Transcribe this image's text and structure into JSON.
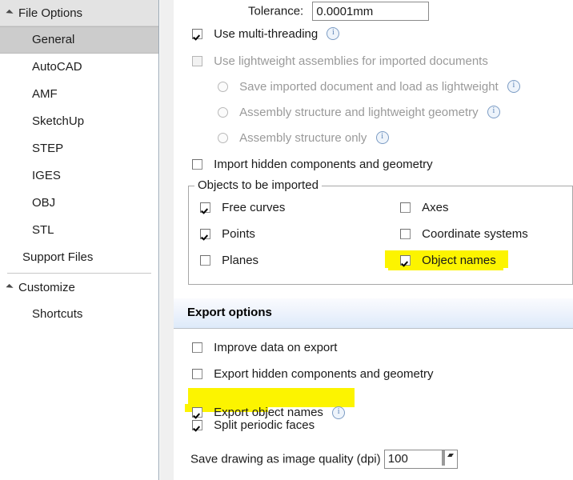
{
  "sidebar": {
    "groups": [
      {
        "label": "File Options",
        "expanded": true
      },
      {
        "label": "Customize",
        "expanded": true
      }
    ],
    "file_options_items": [
      {
        "label": "General",
        "selected": true
      },
      {
        "label": "AutoCAD",
        "selected": false
      },
      {
        "label": "AMF",
        "selected": false
      },
      {
        "label": "SketchUp",
        "selected": false
      },
      {
        "label": "STEP",
        "selected": false
      },
      {
        "label": "IGES",
        "selected": false
      },
      {
        "label": "OBJ",
        "selected": false
      },
      {
        "label": "STL",
        "selected": false
      },
      {
        "label": "Support Files",
        "selected": false
      }
    ],
    "customize_items": [
      {
        "label": "Shortcuts",
        "selected": false
      }
    ]
  },
  "import_options": {
    "tolerance_label": "Tolerance:",
    "tolerance_value": "0.0001mm",
    "multi_threading": {
      "label": "Use multi-threading",
      "checked": true,
      "has_info": true
    },
    "lightweight": {
      "label": "Use lightweight assemblies for imported documents",
      "checked": false,
      "disabled": true
    },
    "lightweight_radios": [
      {
        "label": "Save imported document and load as lightweight",
        "selected": false,
        "has_info": true
      },
      {
        "label": "Assembly structure and lightweight geometry",
        "selected": false,
        "has_info": true
      },
      {
        "label": "Assembly structure only",
        "selected": false,
        "has_info": true
      }
    ],
    "import_hidden": {
      "label": "Import hidden components and geometry",
      "checked": false
    },
    "objects_group": {
      "title": "Objects to be imported",
      "left_column": [
        {
          "label": "Free curves",
          "checked": true,
          "highlighted": false
        },
        {
          "label": "Points",
          "checked": true,
          "highlighted": false
        },
        {
          "label": "Planes",
          "checked": false,
          "highlighted": false
        }
      ],
      "right_column": [
        {
          "label": "Axes",
          "checked": false,
          "highlighted": false
        },
        {
          "label": "Coordinate systems",
          "checked": false,
          "highlighted": false
        },
        {
          "label": "Object names",
          "checked": true,
          "highlighted": true
        }
      ]
    }
  },
  "export_options": {
    "title": "Export options",
    "items": [
      {
        "label": "Improve data on export",
        "checked": false,
        "has_info": false,
        "highlighted": false
      },
      {
        "label": "Export hidden components and geometry",
        "checked": false,
        "has_info": false,
        "highlighted": false
      },
      {
        "label": "Export object names",
        "checked": true,
        "has_info": true,
        "highlighted": true
      },
      {
        "label": "Split periodic faces",
        "checked": true,
        "has_info": false,
        "highlighted": false
      }
    ],
    "dpi_label": "Save drawing as image quality (dpi)",
    "dpi_value": "100"
  },
  "colors": {
    "highlight": "#fcf400",
    "selected_nav": "#cccccc",
    "banner_accent": "#ddeafa"
  }
}
